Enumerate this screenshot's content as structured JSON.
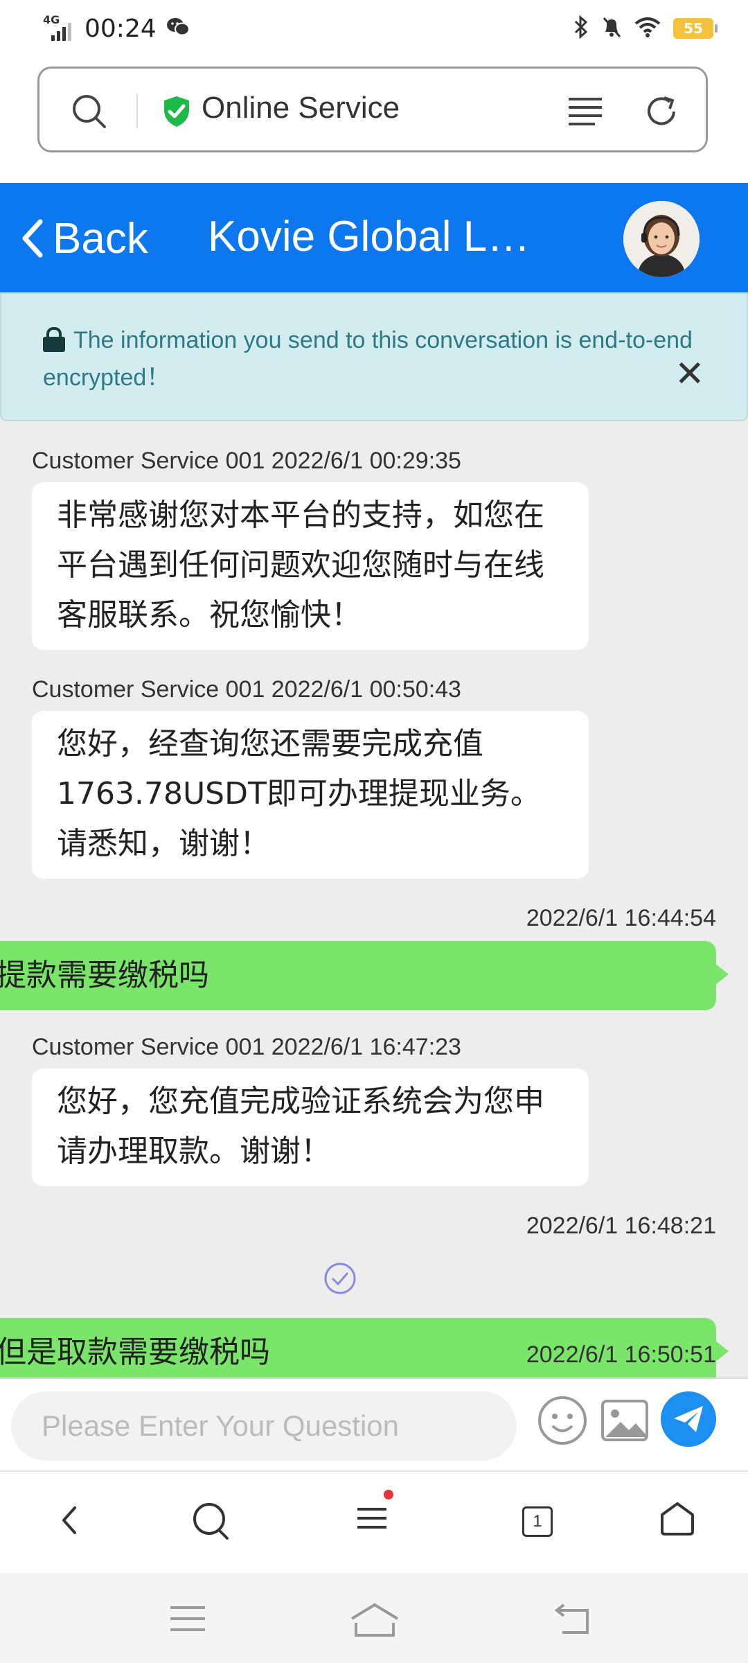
{
  "status_bar": {
    "network": "4G",
    "time": "00:24",
    "battery": "55",
    "icons": [
      "signal-icon",
      "wechat-icon",
      "bluetooth-icon",
      "mute-icon",
      "wifi-icon",
      "battery-icon"
    ]
  },
  "url_bar": {
    "title": "Online Service",
    "icons": [
      "search-icon",
      "secure-shield-icon",
      "menu-icon",
      "reload-icon"
    ]
  },
  "chat_header": {
    "back_label": "Back",
    "title": "Kovie Global L…",
    "color": "#0d77f0"
  },
  "notice": {
    "text": "The information you send to this conversation is end-to-end encrypted！",
    "close": "✕"
  },
  "messages": [
    {
      "direction": "in",
      "meta": "Customer Service 001 2022/6/1 00:29:35",
      "text": "非常感谢您对本平台的支持，如您在平台遇到任何问题欢迎您随时与在线客服联系。祝您愉快！"
    },
    {
      "direction": "in",
      "meta": "Customer Service 001 2022/6/1 00:50:43",
      "text": "您好，经查询您还需要完成充值1763.78USDT即可办理提现业务。请悉知，谢谢！"
    },
    {
      "direction": "out",
      "meta": "2022/6/1 16:44:54",
      "text": "提款需要缴税吗"
    },
    {
      "direction": "in",
      "meta": "Customer Service 001 2022/6/1 16:47:23",
      "text": "您好，您充值完成验证系统会为您申请办理取款。谢谢！"
    },
    {
      "direction": "out",
      "meta": "2022/6/1 16:48:21",
      "text": "但是取款需要缴税吗"
    },
    {
      "direction": "out",
      "meta": "2022/6/1 16:50:51",
      "text": ""
    }
  ],
  "composer": {
    "placeholder": "Please Enter Your Question",
    "icons": [
      "emoji-icon",
      "image-icon",
      "send-icon"
    ]
  },
  "browser_nav": {
    "tab_count": "1",
    "icons": [
      "back-icon",
      "search-icon",
      "menu-icon",
      "tabs-icon",
      "home-icon"
    ]
  },
  "system_nav": {
    "icons": [
      "recents-icon",
      "home-icon",
      "back-icon"
    ]
  }
}
